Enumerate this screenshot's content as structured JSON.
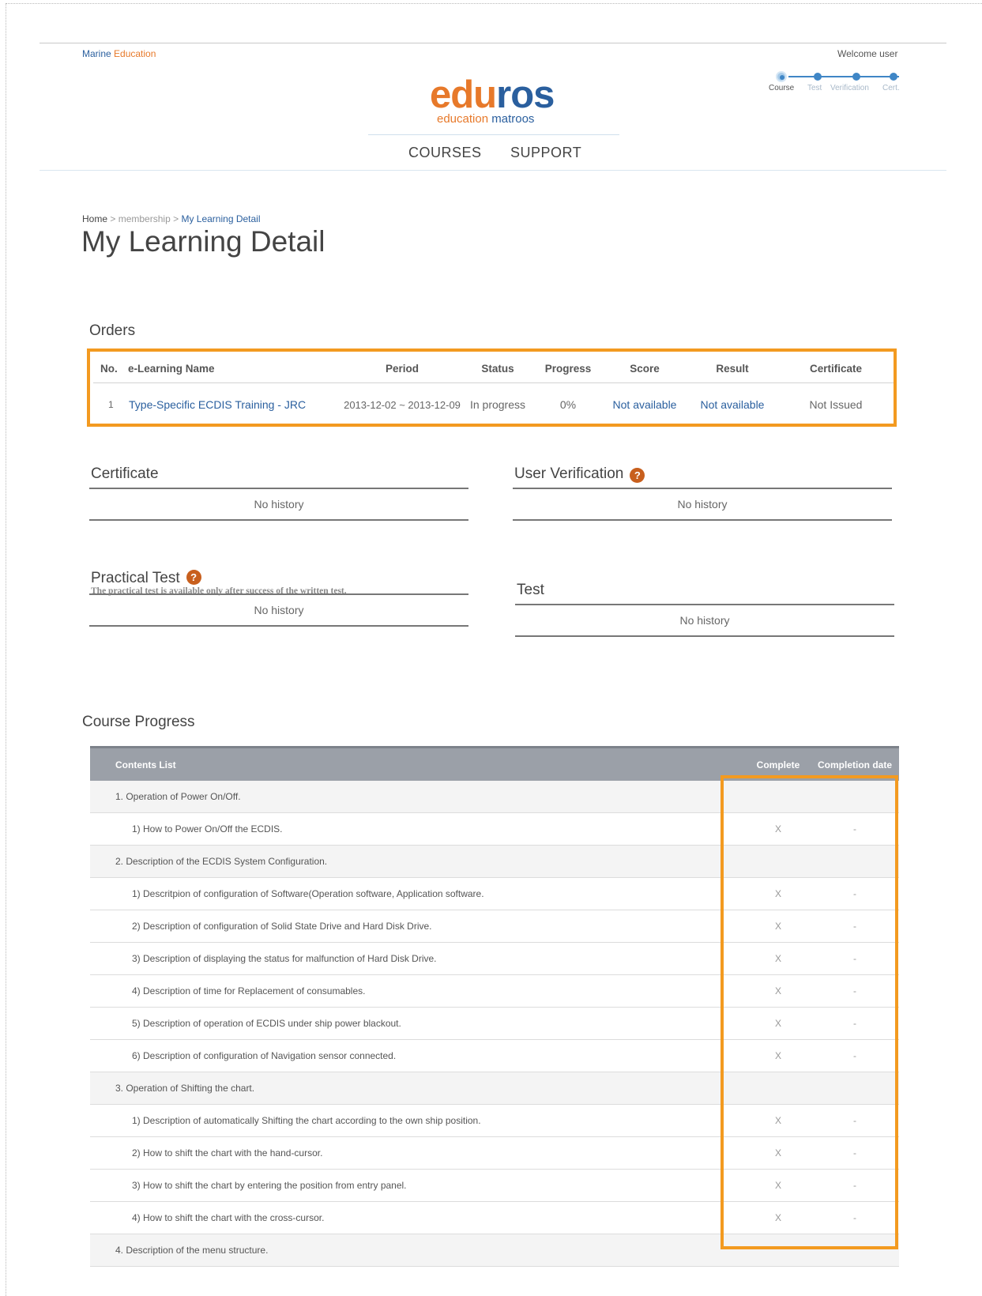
{
  "header": {
    "brand_left_1": "Marine",
    "brand_left_2": "Education",
    "welcome": "Welcome user",
    "steps": [
      "Course",
      "Test",
      "Verification",
      "Cert."
    ],
    "logo_part1": "edu",
    "logo_part2": "ros",
    "logo_tag_1": "education",
    "logo_tag_2": "matroos",
    "nav": [
      "COURSES",
      "SUPPORT"
    ]
  },
  "breadcrumb": {
    "home": "Home",
    "sep": ">",
    "membership": "membership",
    "current": "My Learning Detail"
  },
  "page_title": "My Learning Detail",
  "orders": {
    "title": "Orders",
    "columns": [
      "No.",
      "e-Learning Name",
      "Period",
      "Status",
      "Progress",
      "Score",
      "Result",
      "Certificate"
    ],
    "rows": [
      {
        "no": "1",
        "name": "Type-Specific ECDIS Training - JRC",
        "period": "2013-12-02 ~ 2013-12-09",
        "status": "In progress",
        "progress": "0%",
        "score": "Not available",
        "result": "Not available",
        "certificate": "Not Issued"
      }
    ]
  },
  "panels": {
    "certificate": {
      "title": "Certificate",
      "row": "No history"
    },
    "user_verification": {
      "title": "User Verification",
      "row": "No history"
    },
    "practical_test": {
      "title": "Practical Test",
      "subtitle": "The practical test is available only after success of the written test.",
      "row": "No history"
    },
    "test": {
      "title": "Test",
      "row": "No history"
    },
    "help_glyph": "?"
  },
  "course_progress": {
    "title": "Course Progress",
    "columns": [
      "Contents List",
      "Complete",
      "Completion date"
    ],
    "rows": [
      {
        "type": "cat",
        "name": "1. Operation of Power On/Off.",
        "complete": "",
        "date": ""
      },
      {
        "type": "item",
        "name": "1) How to Power On/Off the ECDIS.",
        "complete": "X",
        "date": "-"
      },
      {
        "type": "cat",
        "name": "2. Description of the ECDIS System Configuration.",
        "complete": "",
        "date": ""
      },
      {
        "type": "item",
        "name": "1) Descritpion of configuration of Software(Operation software, Application software.",
        "complete": "X",
        "date": "-"
      },
      {
        "type": "item",
        "name": "2) Description of configuration of Solid State Drive and Hard Disk Drive.",
        "complete": "X",
        "date": "-"
      },
      {
        "type": "item",
        "name": "3) Description of displaying the status for malfunction of Hard Disk Drive.",
        "complete": "X",
        "date": "-"
      },
      {
        "type": "item",
        "name": "4) Description of time for Replacement of consumables.",
        "complete": "X",
        "date": "-"
      },
      {
        "type": "item",
        "name": "5) Description of operation of ECDIS under ship power blackout.",
        "complete": "X",
        "date": "-"
      },
      {
        "type": "item",
        "name": "6) Description of configuration of Navigation sensor connected.",
        "complete": "X",
        "date": "-"
      },
      {
        "type": "cat",
        "name": "3. Operation of Shifting the chart.",
        "complete": "",
        "date": ""
      },
      {
        "type": "item",
        "name": "1) Description of automatically Shifting the chart according to the own ship position.",
        "complete": "X",
        "date": "-"
      },
      {
        "type": "item",
        "name": "2) How to shift the chart with the hand-cursor.",
        "complete": "X",
        "date": "-"
      },
      {
        "type": "item",
        "name": "3) How to shift the chart by entering the position from entry panel.",
        "complete": "X",
        "date": "-"
      },
      {
        "type": "item",
        "name": "4) How to shift the chart with the cross-cursor.",
        "complete": "X",
        "date": "-"
      },
      {
        "type": "cat",
        "name": "4. Description of the menu structure.",
        "complete": "",
        "date": ""
      }
    ]
  },
  "colors": {
    "brand_orange": "#e7792a",
    "brand_blue": "#2a5f9e",
    "highlight": "#f39a20",
    "help_icon": "#c85f1d",
    "table_header": "#9ba0a8"
  }
}
